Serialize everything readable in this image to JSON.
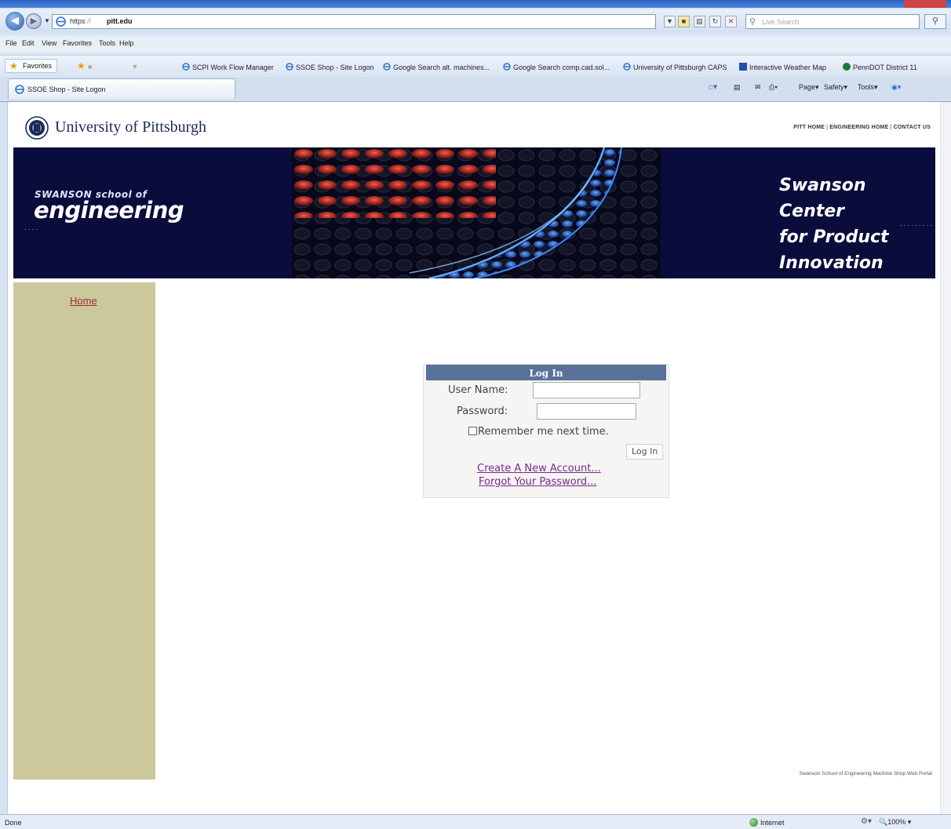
{
  "browser": {
    "address": {
      "scheme": "https",
      "host_mid": "pitt.edu"
    },
    "search": {
      "placeholder": "Live Search"
    },
    "menu": [
      "File",
      "Edit",
      "View",
      "Favorites",
      "Tools",
      "Help"
    ],
    "favorites": {
      "button": "Favorites",
      "links": [
        "SCPI Work Flow Manager",
        "SSOE Shop - Site Logon",
        "Google Search alt. machines...",
        "Google Search comp.cad.sol...",
        "University of Pittsburgh CAPS",
        "Interactive Weather Map",
        "PennDOT District 11"
      ]
    },
    "tab": {
      "title": "SSOE Shop - Site Logon"
    },
    "commands": [
      "Page",
      "Safety",
      "Tools"
    ],
    "status": {
      "text": "Done",
      "zone": "Internet",
      "zoom": "100%"
    }
  },
  "page": {
    "university": "University of Pittsburgh",
    "toplinks": [
      "PITT HOME",
      "ENGINEERING HOME",
      "CONTACT US"
    ],
    "banner": {
      "school_small": "SWANSON school of",
      "school_big": "engineering",
      "center_lines": [
        "Swanson Center",
        "for Product",
        "Innovation"
      ]
    },
    "nav": {
      "home": "Home"
    },
    "login": {
      "title": "Log In",
      "username_label": "User Name:",
      "password_label": "Password:",
      "remember_label": "Remember me next time.",
      "button": "Log In",
      "create_link": "Create A New Account...",
      "forgot_link": "Forgot Your Password..."
    },
    "footer": "Swanson School of Engineering Machine Shop Web Portal"
  },
  "colors": {
    "banner_bg": "#0a0c3c",
    "nav_bg": "#cbc89c",
    "login_header": "#5a7199",
    "link_visited": "#7a2a8e",
    "home_link": "#9a2e36"
  }
}
